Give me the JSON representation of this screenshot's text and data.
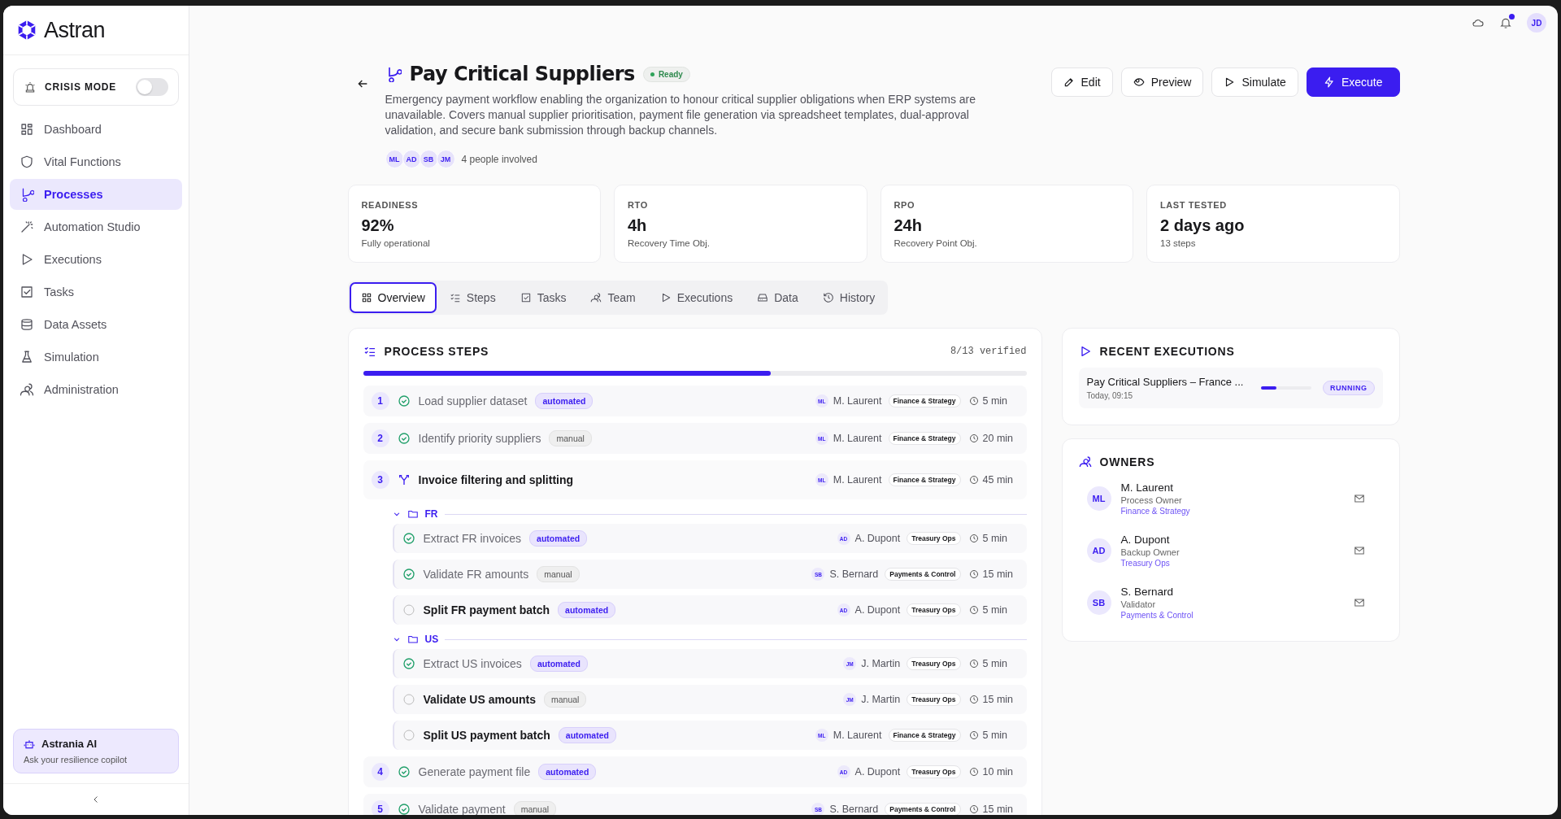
{
  "brand": {
    "name": "Astran"
  },
  "crisis_mode": {
    "label": "CRISIS MODE",
    "on": false
  },
  "nav": [
    {
      "label": "Dashboard",
      "selected": false
    },
    {
      "label": "Vital Functions",
      "selected": false
    },
    {
      "label": "Processes",
      "selected": true
    },
    {
      "label": "Automation Studio",
      "selected": false
    },
    {
      "label": "Executions",
      "selected": false
    },
    {
      "label": "Tasks",
      "selected": false
    },
    {
      "label": "Data Assets",
      "selected": false
    },
    {
      "label": "Simulation",
      "selected": false
    },
    {
      "label": "Administration",
      "selected": false
    }
  ],
  "assistant": {
    "title": "Astrania AI",
    "subtitle": "Ask your resilience copilot"
  },
  "topbar": {
    "notifications": true,
    "user_initials": "JD"
  },
  "process": {
    "title": "Pay Critical Suppliers",
    "status": "Ready",
    "description": "Emergency payment workflow enabling the organization to honour critical supplier obligations when ERP systems are unavailable. Covers manual supplier prioritisation, payment file generation via spreadsheet templates, dual-approval validation, and secure bank submission through backup channels.",
    "people": [
      "ML",
      "AD",
      "SB",
      "JM"
    ],
    "people_label": "4 people involved"
  },
  "actions": [
    {
      "label": "Edit",
      "primary": false
    },
    {
      "label": "Preview",
      "primary": false
    },
    {
      "label": "Simulate",
      "primary": false
    },
    {
      "label": "Execute",
      "primary": true
    }
  ],
  "stats": [
    {
      "label": "READINESS",
      "value": "92%",
      "sub": "Fully operational"
    },
    {
      "label": "RTO",
      "value": "4h",
      "sub": "Recovery Time Obj."
    },
    {
      "label": "RPO",
      "value": "24h",
      "sub": "Recovery Point Obj."
    },
    {
      "label": "LAST TESTED",
      "value": "2 days ago",
      "sub": "13 steps"
    }
  ],
  "tabs": [
    {
      "label": "Overview",
      "selected": true
    },
    {
      "label": "Steps",
      "selected": false
    },
    {
      "label": "Tasks",
      "selected": false
    },
    {
      "label": "Team",
      "selected": false
    },
    {
      "label": "Executions",
      "selected": false
    },
    {
      "label": "Data",
      "selected": false
    },
    {
      "label": "History",
      "selected": false
    }
  ],
  "process_steps": {
    "title": "PROCESS STEPS",
    "verified_label": "8/13 verified",
    "level": 0.615,
    "rows": [
      {
        "kind": "step",
        "number": "1",
        "title": "Load supplier dataset",
        "verified": true,
        "tag": "automated",
        "tag_accent": true,
        "initials": "ML",
        "owner": "M. Laurent",
        "team": "Finance & Strategy",
        "duration": "5 min"
      },
      {
        "kind": "step",
        "number": "2",
        "title": "Identify priority suppliers",
        "verified": true,
        "tag": "manual",
        "tag_accent": false,
        "initials": "ML",
        "owner": "M. Laurent",
        "team": "Finance & Strategy",
        "duration": "20 min"
      },
      {
        "kind": "branch",
        "number": "3",
        "title": "Invoice filtering and splitting",
        "initials": "ML",
        "owner": "M. Laurent",
        "team": "Finance & Strategy",
        "duration": "45 min"
      },
      {
        "kind": "group",
        "label": "FR",
        "expanded": true,
        "children": [
          {
            "title": "Extract FR invoices",
            "verified": true,
            "tag": "automated",
            "tag_accent": true,
            "initials": "AD",
            "owner": "A. Dupont",
            "team": "Treasury Ops",
            "duration": "5 min"
          },
          {
            "title": "Validate FR amounts",
            "verified": true,
            "tag": "manual",
            "tag_accent": false,
            "initials": "SB",
            "owner": "S. Bernard",
            "team": "Payments & Control",
            "duration": "15 min"
          },
          {
            "title": "Split FR payment batch",
            "verified": false,
            "tag": "automated",
            "tag_accent": true,
            "initials": "AD",
            "owner": "A. Dupont",
            "team": "Treasury Ops",
            "duration": "5 min"
          }
        ]
      },
      {
        "kind": "group",
        "label": "US",
        "expanded": true,
        "children": [
          {
            "title": "Extract US invoices",
            "verified": true,
            "tag": "automated",
            "tag_accent": true,
            "initials": "JM",
            "owner": "J. Martin",
            "team": "Treasury Ops",
            "duration": "5 min"
          },
          {
            "title": "Validate US amounts",
            "verified": false,
            "tag": "manual",
            "tag_accent": false,
            "initials": "JM",
            "owner": "J. Martin",
            "team": "Treasury Ops",
            "duration": "15 min"
          },
          {
            "title": "Split US payment batch",
            "verified": false,
            "tag": "automated",
            "tag_accent": true,
            "initials": "ML",
            "owner": "M. Laurent",
            "team": "Finance & Strategy",
            "duration": "5 min"
          }
        ]
      },
      {
        "kind": "step",
        "number": "4",
        "title": "Generate payment file",
        "verified": true,
        "tag": "automated",
        "tag_accent": true,
        "initials": "AD",
        "owner": "A. Dupont",
        "team": "Treasury Ops",
        "duration": "10 min"
      },
      {
        "kind": "step",
        "number": "5",
        "title": "Validate payment",
        "verified": true,
        "tag": "manual",
        "tag_accent": false,
        "initials": "SB",
        "owner": "S. Bernard",
        "team": "Payments & Control",
        "duration": "15 min"
      }
    ]
  },
  "recent_executions": {
    "title": "RECENT EXECUTIONS",
    "items": [
      {
        "name": "Pay Critical Suppliers – France ...",
        "time": "Today, 09:15",
        "level": 0.3,
        "status": "RUNNING"
      }
    ]
  },
  "owners": {
    "title": "OWNERS",
    "items": [
      {
        "initials": "ML",
        "name": "M. Laurent",
        "role": "Process Owner",
        "team": "Finance & Strategy"
      },
      {
        "initials": "AD",
        "name": "A. Dupont",
        "role": "Backup Owner",
        "team": "Treasury Ops"
      },
      {
        "initials": "SB",
        "name": "S. Bernard",
        "role": "Validator",
        "team": "Payments & Control"
      }
    ]
  }
}
